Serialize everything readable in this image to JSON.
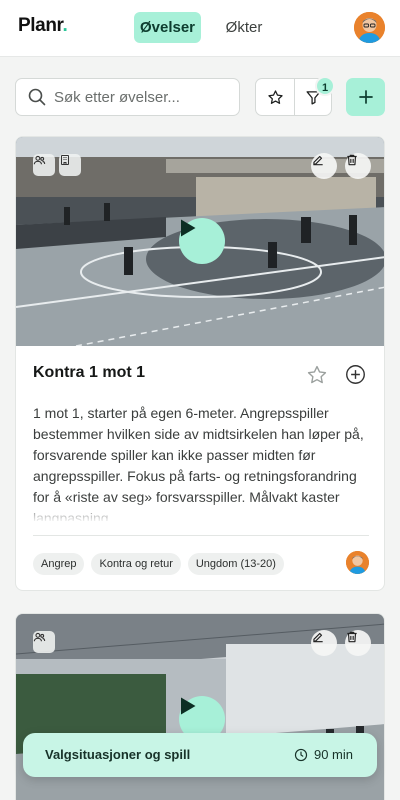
{
  "header": {
    "logo": "Planr",
    "logo_dot": ".",
    "tabs": [
      {
        "label": "Øvelser",
        "active": true
      },
      {
        "label": "Økter",
        "active": false
      }
    ],
    "accent_color": "#a7f0d8"
  },
  "toolbar": {
    "search_placeholder": "Søk etter øvelser...",
    "filter_count": "1",
    "icons": [
      "search-icon",
      "star-icon",
      "filter-icon",
      "plus-icon"
    ]
  },
  "exercises": [
    {
      "title": "Kontra 1 mot 1",
      "description": "1 mot 1, starter på egen 6-meter. Angrepsspiller bestemmer hvilken side av midtsirkelen han løper på, forsvarende spiller kan ikke passer midten før angrepsspiller. Fokus på farts- og retningsforandring for å «riste av seg» forsvarsspiller. Målvakt kaster langpasning.",
      "tags": [
        "Angrep",
        "Kontra og retur",
        "Ungdom (13-20)"
      ]
    }
  ],
  "session_bar": {
    "title": "Valgsituasjoner og spill",
    "duration": "90 min"
  }
}
